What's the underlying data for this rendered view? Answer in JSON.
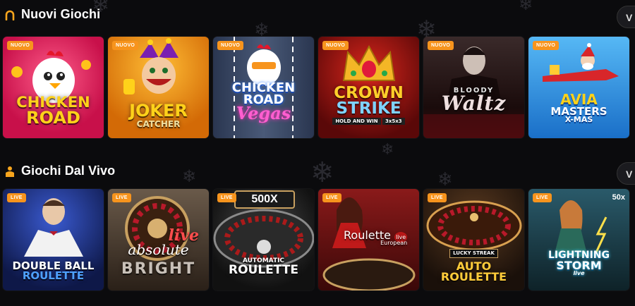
{
  "sections": [
    {
      "title": "Nuovi Giochi",
      "see_all": "V",
      "games": [
        {
          "badge": "NUOVO",
          "logo_1": "CHICKEN",
          "logo_2": "ROAD",
          "bg": "#e01a5a"
        },
        {
          "badge": "NUOVO",
          "logo_1": "JOKER",
          "logo_2": "CATCHER",
          "bg": "#e88b10"
        },
        {
          "badge": "NUOVO",
          "logo_1": "CHICKEN",
          "logo_2": "ROAD",
          "logo_3": "Vegas",
          "bg": "#3a4a60"
        },
        {
          "badge": "NUOVO",
          "logo_1": "CROWN",
          "logo_2": "STRIKE",
          "logo_3": "HOLD AND WIN",
          "logo_4": "3x5x3",
          "bg": "#8e1010"
        },
        {
          "badge": "NUOVO",
          "logo_1": "BLOODY",
          "logo_2": "Waltz",
          "bg": "#2a1414"
        },
        {
          "badge": "NUOVO",
          "logo_1": "AVIA",
          "logo_2": "MASTERS",
          "logo_3": "X-MAS",
          "bg": "#2a9ee0"
        }
      ]
    },
    {
      "title": "Giochi Dal Vivo",
      "see_all": "V",
      "games": [
        {
          "badge": "LIVE",
          "logo_1": "DOUBLE BALL",
          "logo_2": "ROULETTE",
          "bg": "#1a2a6a"
        },
        {
          "badge": "LIVE",
          "logo_1": "live",
          "logo_2": "absolute",
          "logo_3": "BRIGHT",
          "bg": "#5a4030"
        },
        {
          "badge": "LIVE",
          "logo_1": "500X",
          "logo_2": "AUTOMATIC",
          "logo_3": "ROULETTE",
          "bg": "#1b1b1b"
        },
        {
          "badge": "LIVE",
          "logo_1": "Roulette",
          "logo_2": "live",
          "logo_3": "European",
          "bg": "#7a1a1a"
        },
        {
          "badge": "LIVE",
          "logo_1": "LUCKY STREAK",
          "logo_2": "AUTO",
          "logo_3": "ROULETTE",
          "bg": "#3a2a1a"
        },
        {
          "badge": "LIVE",
          "logo_1": "LIGHTNING",
          "logo_2": "STORM",
          "logo_3": "live",
          "logo_4": "50x",
          "bg": "#1a3a4a"
        }
      ]
    }
  ],
  "colors": {
    "badge": "#f7941d",
    "accent": "#f7a51d",
    "background": "#0b0b0d"
  }
}
